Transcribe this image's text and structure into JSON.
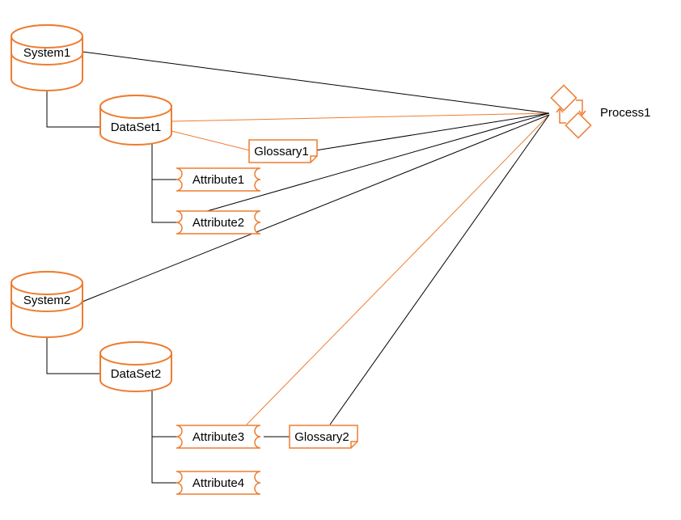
{
  "colors": {
    "orange": "#ED7D31",
    "black": "#000000"
  },
  "process": {
    "label": "Process1"
  },
  "systems": [
    {
      "label": "System1"
    },
    {
      "label": "System2"
    }
  ],
  "datasets": [
    {
      "label": "DataSet1"
    },
    {
      "label": "DataSet2"
    }
  ],
  "attributes": [
    {
      "label": "Attribute1"
    },
    {
      "label": "Attribute2"
    },
    {
      "label": "Attribute3"
    },
    {
      "label": "Attribute4"
    }
  ],
  "glossaries": [
    {
      "label": "Glossary1"
    },
    {
      "label": "Glossary2"
    }
  ]
}
